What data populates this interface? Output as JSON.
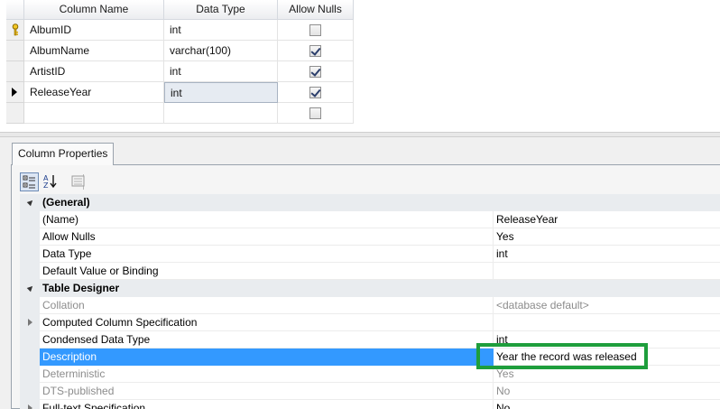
{
  "table_grid": {
    "headers": {
      "column_name": "Column Name",
      "data_type": "Data Type",
      "allow_nulls": "Allow Nulls"
    },
    "rows": [
      {
        "name": "AlbumID",
        "type": "int",
        "allow_nulls": false,
        "primary_key": true
      },
      {
        "name": "AlbumName",
        "type": "varchar(100)",
        "allow_nulls": true
      },
      {
        "name": "ArtistID",
        "type": "int",
        "allow_nulls": true
      },
      {
        "name": "ReleaseYear",
        "type": "int",
        "allow_nulls": true,
        "current": true
      },
      {
        "name": "",
        "type": "",
        "allow_nulls": false
      }
    ]
  },
  "tab": {
    "label": "Column Properties"
  },
  "toolbar": {
    "icons": [
      "categorized-icon",
      "alphabetical-sort-icon",
      "property-pages-icon"
    ]
  },
  "properties": {
    "general": {
      "label": "(General)",
      "name": {
        "label": "(Name)",
        "value": "ReleaseYear"
      },
      "allow_nulls": {
        "label": "Allow Nulls",
        "value": "Yes"
      },
      "data_type": {
        "label": "Data Type",
        "value": "int"
      },
      "default_value": {
        "label": "Default Value or Binding",
        "value": ""
      }
    },
    "table_designer": {
      "label": "Table Designer",
      "collation": {
        "label": "Collation",
        "value": "<database default>"
      },
      "computed": {
        "label": "Computed Column Specification",
        "value": ""
      },
      "condensed": {
        "label": "Condensed Data Type",
        "value": "int"
      },
      "description": {
        "label": "Description",
        "value": "Year the record was released"
      },
      "deterministic": {
        "label": "Deterministic",
        "value": "Yes"
      },
      "dts": {
        "label": "DTS-published",
        "value": "No"
      },
      "fulltext": {
        "label": "Full-text Specification",
        "value": "No"
      }
    }
  },
  "colors": {
    "selection": "#3399ff",
    "highlight_box": "#1e9e3c"
  }
}
